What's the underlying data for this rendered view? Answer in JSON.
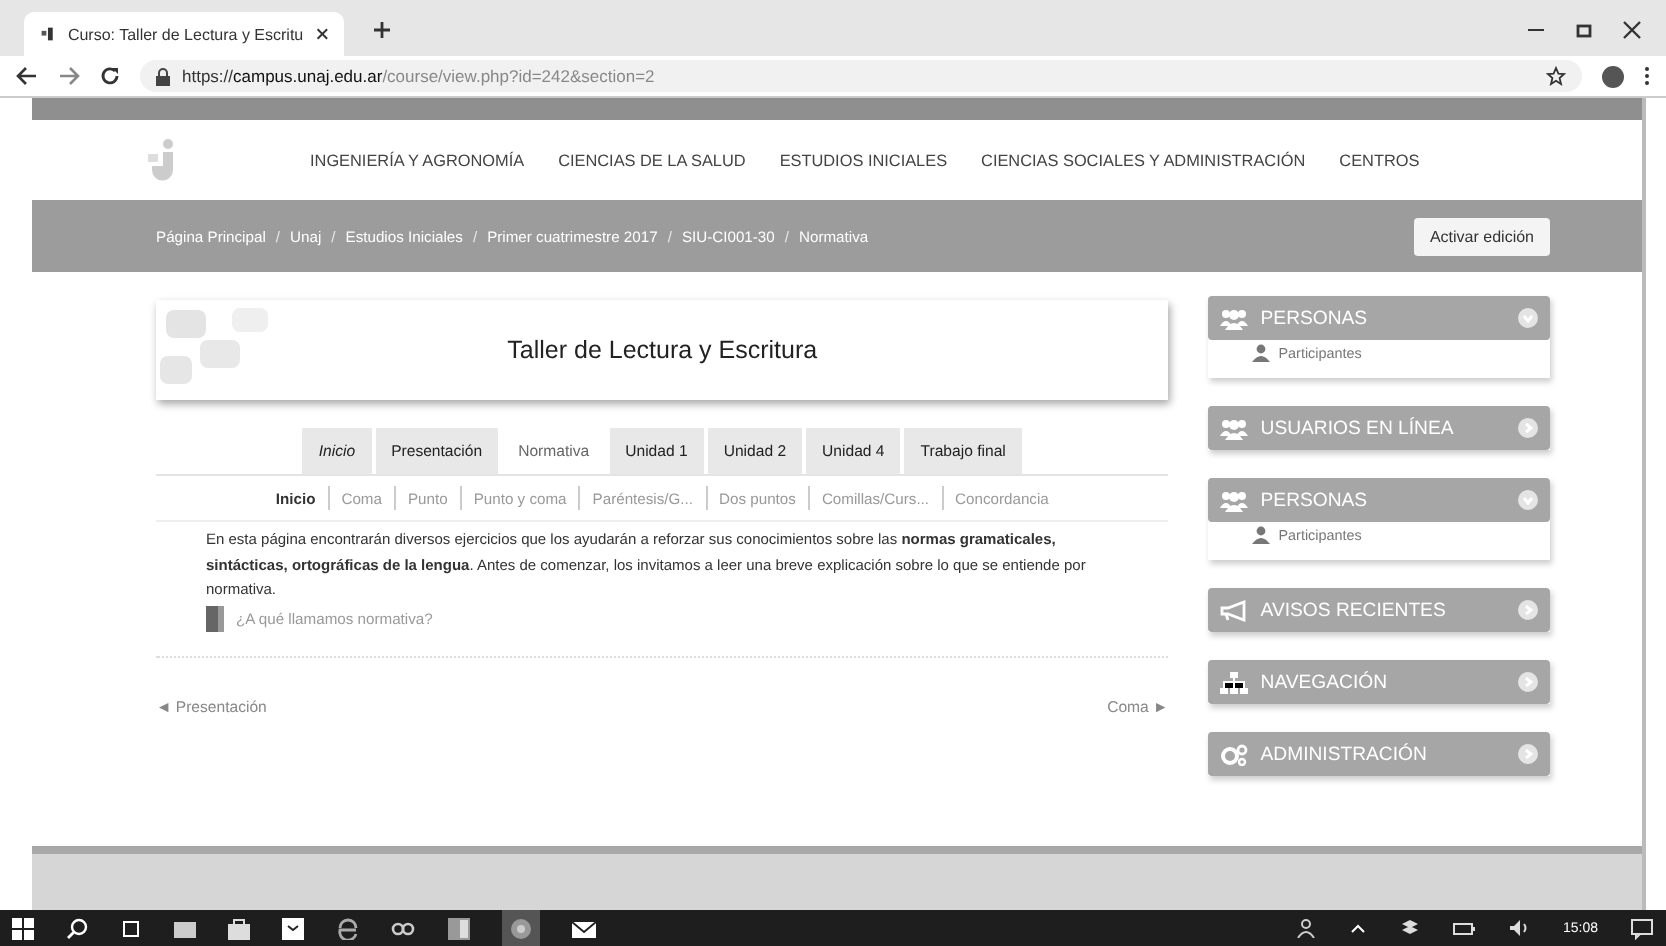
{
  "browser": {
    "tab_title": "Curso: Taller de Lectura y Escritu",
    "url_scheme": "https://",
    "url_host": "campus.unaj.edu.ar",
    "url_path": "/course/view.php?id=242&section=2"
  },
  "nav": [
    "INGENIERÍA Y AGRONOMÍA",
    "CIENCIAS DE LA SALUD",
    "ESTUDIOS INICIALES",
    "CIENCIAS SOCIALES Y ADMINISTRACIÓN",
    "CENTROS"
  ],
  "breadcrumb": [
    {
      "label": "Página Principal",
      "kind": "link"
    },
    {
      "label": "/",
      "kind": "separator"
    },
    {
      "label": "Unaj",
      "kind": "link"
    },
    {
      "label": "/",
      "kind": "separator"
    },
    {
      "label": "Estudios Iniciales",
      "kind": "link"
    },
    {
      "label": "/",
      "kind": "separator"
    },
    {
      "label": "Primer cuatrimestre 2017",
      "kind": "link"
    },
    {
      "label": "/",
      "kind": "separator"
    },
    {
      "label": "SIU-CI001-30",
      "kind": "link"
    },
    {
      "label": "/",
      "kind": "separator"
    },
    {
      "label": "Normativa",
      "kind": "link"
    }
  ],
  "edit_button": "Activar edición",
  "course_title": "Taller de Lectura y Escritura",
  "tabs": [
    {
      "label": "Inicio",
      "kind": "home",
      "selected": false
    },
    {
      "label": "Presentación",
      "kind": "section",
      "selected": false
    },
    {
      "label": "Normativa",
      "kind": "section",
      "selected": true
    },
    {
      "label": "Unidad 1",
      "kind": "section",
      "selected": false
    },
    {
      "label": "Unidad 2",
      "kind": "section",
      "selected": false
    },
    {
      "label": "Unidad 4",
      "kind": "section",
      "selected": false
    },
    {
      "label": "Trabajo final",
      "kind": "section",
      "selected": false
    }
  ],
  "subnav": [
    {
      "label": "Inicio",
      "selected": true
    },
    {
      "label": "Coma",
      "selected": false
    },
    {
      "label": "Punto",
      "selected": false
    },
    {
      "label": "Punto y coma",
      "selected": false
    },
    {
      "label": "Paréntesis/G...",
      "selected": false
    },
    {
      "label": "Dos puntos",
      "selected": false
    },
    {
      "label": "Comillas/Curs...",
      "selected": false
    },
    {
      "label": "Concordancia",
      "selected": false
    }
  ],
  "intro": "En esta página encontrarán diversos ejercicios que los ayudarán a reforzar sus conocimientos sobre las **normas gramaticales, sintácticas, ortográficas de la lengua**. Antes de comenzar, los invitamos a leer una breve explicación sobre lo que se entiende por normativa.",
  "resource_link": "¿A qué llamamos normativa?",
  "prev_link": "◄ Presentación",
  "next_link": "Coma ►",
  "blocks": [
    {
      "title": "PERSONAS",
      "kind": "people",
      "expanded": true,
      "items": [
        "Participantes"
      ]
    },
    {
      "title": "USUARIOS EN LÍNEA",
      "kind": "people",
      "expanded": false
    },
    {
      "title": "PERSONAS",
      "kind": "people",
      "expanded": true,
      "items": [
        "Participantes"
      ]
    },
    {
      "title": "AVISOS RECIENTES",
      "kind": "announcements",
      "expanded": false
    },
    {
      "title": "NAVEGACIÓN",
      "kind": "navigation",
      "expanded": false
    },
    {
      "title": "ADMINISTRACIÓN",
      "kind": "administration",
      "expanded": false
    }
  ],
  "taskbar": {
    "time": "15:08"
  }
}
